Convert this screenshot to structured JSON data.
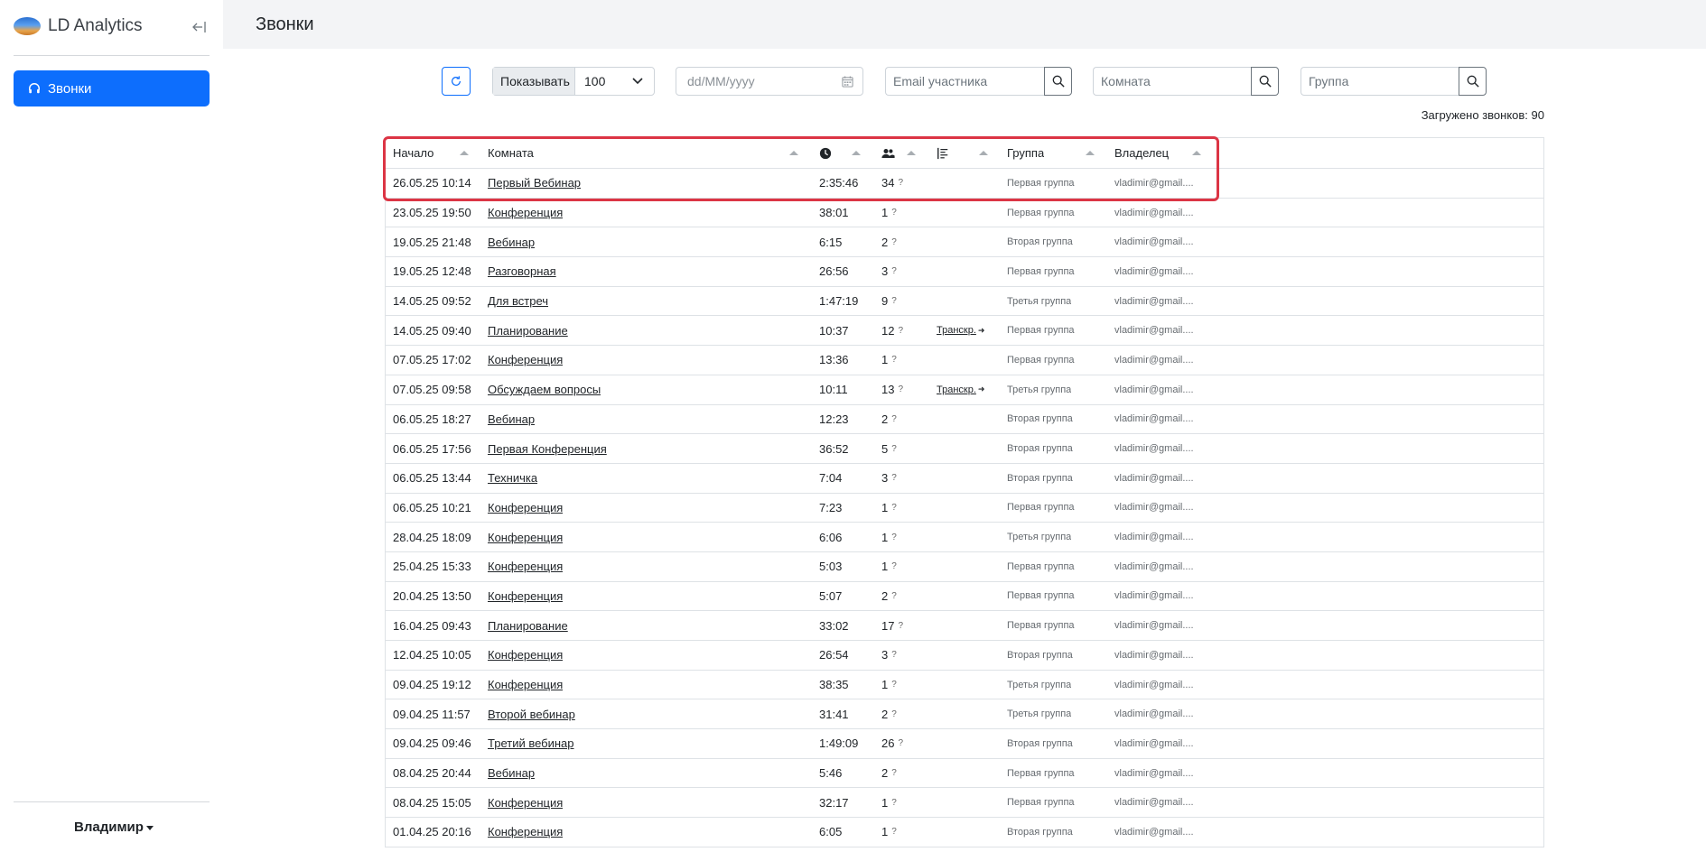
{
  "app": {
    "brand": "LD Analytics"
  },
  "sidebar": {
    "nav": [
      {
        "label": "Звонки",
        "active": true
      }
    ],
    "user": "Владимир"
  },
  "page": {
    "title": "Звонки"
  },
  "filters": {
    "show_label": "Показывать",
    "show_value": "100",
    "date_placeholder": "dd/MM/yyyy",
    "email_placeholder": "Email участника",
    "room_placeholder": "Комната",
    "group_placeholder": "Группа"
  },
  "summary": {
    "loaded_text": "Загружено звонков: 90"
  },
  "table": {
    "headers": {
      "start": "Начало",
      "room": "Комната",
      "group": "Группа",
      "owner": "Владелец"
    },
    "rows": [
      {
        "start": "26.05.25 10:14",
        "room": "Первый Вебинар",
        "duration": "2:35:46",
        "participants": "34",
        "transcript": "",
        "group": "Первая группа",
        "owner": "vladimir@gmail...."
      },
      {
        "start": "23.05.25 19:50",
        "room": "Конференция",
        "duration": "38:01",
        "participants": "1",
        "transcript": "",
        "group": "Первая группа",
        "owner": "vladimir@gmail...."
      },
      {
        "start": "19.05.25 21:48",
        "room": "Вебинар",
        "duration": "6:15",
        "participants": "2",
        "transcript": "",
        "group": "Вторая группа",
        "owner": "vladimir@gmail...."
      },
      {
        "start": "19.05.25 12:48",
        "room": "Разговорная",
        "duration": "26:56",
        "participants": "3",
        "transcript": "",
        "group": "Первая группа",
        "owner": "vladimir@gmail...."
      },
      {
        "start": "14.05.25 09:52",
        "room": "Для встреч",
        "duration": "1:47:19",
        "participants": "9",
        "transcript": "",
        "group": "Третья группа",
        "owner": "vladimir@gmail...."
      },
      {
        "start": "14.05.25 09:40",
        "room": "Планирование",
        "duration": "10:37",
        "participants": "12",
        "transcript": "Транскр.",
        "group": "Первая группа",
        "owner": "vladimir@gmail...."
      },
      {
        "start": "07.05.25 17:02",
        "room": "Конференция",
        "duration": "13:36",
        "participants": "1",
        "transcript": "",
        "group": "Первая группа",
        "owner": "vladimir@gmail...."
      },
      {
        "start": "07.05.25 09:58",
        "room": "Обсуждаем вопросы",
        "duration": "10:11",
        "participants": "13",
        "transcript": "Транскр.",
        "group": "Третья группа",
        "owner": "vladimir@gmail...."
      },
      {
        "start": "06.05.25 18:27",
        "room": "Вебинар",
        "duration": "12:23",
        "participants": "2",
        "transcript": "",
        "group": "Вторая группа",
        "owner": "vladimir@gmail...."
      },
      {
        "start": "06.05.25 17:56",
        "room": "Первая Конференция",
        "duration": "36:52",
        "participants": "5",
        "transcript": "",
        "group": "Вторая группа",
        "owner": "vladimir@gmail...."
      },
      {
        "start": "06.05.25 13:44",
        "room": "Техничка",
        "duration": "7:04",
        "participants": "3",
        "transcript": "",
        "group": "Вторая группа",
        "owner": "vladimir@gmail...."
      },
      {
        "start": "06.05.25 10:21",
        "room": "Конференция",
        "duration": "7:23",
        "participants": "1",
        "transcript": "",
        "group": "Первая группа",
        "owner": "vladimir@gmail...."
      },
      {
        "start": "28.04.25 18:09",
        "room": "Конференция",
        "duration": "6:06",
        "participants": "1",
        "transcript": "",
        "group": "Третья группа",
        "owner": "vladimir@gmail...."
      },
      {
        "start": "25.04.25 15:33",
        "room": "Конференция",
        "duration": "5:03",
        "participants": "1",
        "transcript": "",
        "group": "Первая группа",
        "owner": "vladimir@gmail...."
      },
      {
        "start": "20.04.25 13:50",
        "room": "Конференция",
        "duration": "5:07",
        "participants": "2",
        "transcript": "",
        "group": "Первая группа",
        "owner": "vladimir@gmail...."
      },
      {
        "start": "16.04.25 09:43",
        "room": "Планирование",
        "duration": "33:02",
        "participants": "17",
        "transcript": "",
        "group": "Первая группа",
        "owner": "vladimir@gmail...."
      },
      {
        "start": "12.04.25 10:05",
        "room": "Конференция",
        "duration": "26:54",
        "participants": "3",
        "transcript": "",
        "group": "Вторая группа",
        "owner": "vladimir@gmail...."
      },
      {
        "start": "09.04.25 19:12",
        "room": "Конференция",
        "duration": "38:35",
        "participants": "1",
        "transcript": "",
        "group": "Третья группа",
        "owner": "vladimir@gmail...."
      },
      {
        "start": "09.04.25 11:57",
        "room": "Второй вебинар",
        "duration": "31:41",
        "participants": "2",
        "transcript": "",
        "group": "Третья группа",
        "owner": "vladimir@gmail...."
      },
      {
        "start": "09.04.25 09:46",
        "room": "Третий вебинар",
        "duration": "1:49:09",
        "participants": "26",
        "transcript": "",
        "group": "Вторая группа",
        "owner": "vladimir@gmail...."
      },
      {
        "start": "08.04.25 20:44",
        "room": "Вебинар",
        "duration": "5:46",
        "participants": "2",
        "transcript": "",
        "group": "Первая группа",
        "owner": "vladimir@gmail...."
      },
      {
        "start": "08.04.25 15:05",
        "room": "Конференция",
        "duration": "32:17",
        "participants": "1",
        "transcript": "",
        "group": "Первая группа",
        "owner": "vladimir@gmail...."
      },
      {
        "start": "01.04.25 20:16",
        "room": "Конференция",
        "duration": "6:05",
        "participants": "1",
        "transcript": "",
        "group": "Вторая группа",
        "owner": "vladimir@gmail...."
      }
    ]
  },
  "colors": {
    "primary": "#0d6efd",
    "highlight": "#dc3545",
    "sidebar_bg": "#ffffff",
    "page_bg": "#f3f4f6"
  }
}
